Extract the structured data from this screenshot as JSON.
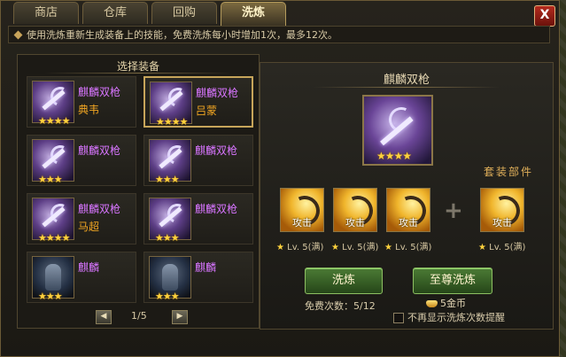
{
  "tabs": [
    {
      "label": "商店",
      "active": false
    },
    {
      "label": "仓库",
      "active": false
    },
    {
      "label": "回购",
      "active": false
    },
    {
      "label": "洗炼",
      "active": true
    }
  ],
  "close_label": "X",
  "tip": "使用洗炼重新生成装备上的技能，免费洗炼每小时增加1次，最多12次。",
  "left_panel": {
    "title": "选择装备",
    "items": [
      {
        "name": "麒麟双枪",
        "owner": "典韦",
        "stars": "★★★★",
        "selected": false,
        "icon": "weapon-icon"
      },
      {
        "name": "麒麟双枪",
        "owner": "吕蒙",
        "stars": "★★★★",
        "selected": true,
        "icon": "weapon-icon"
      },
      {
        "name": "麒麟双枪",
        "owner": "",
        "stars": "★★★",
        "selected": false,
        "icon": "weapon-icon"
      },
      {
        "name": "麒麟双枪",
        "owner": "",
        "stars": "★★★",
        "selected": false,
        "icon": "weapon-icon"
      },
      {
        "name": "麒麟双枪",
        "owner": "马超",
        "stars": "★★★★",
        "selected": false,
        "icon": "weapon-icon"
      },
      {
        "name": "麒麟双枪",
        "owner": "",
        "stars": "★★★",
        "selected": false,
        "icon": "weapon-icon"
      },
      {
        "name": "麒麟",
        "owner": "",
        "stars": "★★★",
        "selected": false,
        "icon": "mount-icon"
      },
      {
        "name": "麒麟",
        "owner": "",
        "stars": "★★★",
        "selected": false,
        "icon": "mount-icon"
      }
    ],
    "page": "1/5"
  },
  "right_panel": {
    "weapon_name": "麒麟双枪",
    "weapon_stars": "★★★★",
    "set_label": "套装部件",
    "parts": [
      {
        "label": "攻击",
        "level": "Lv. 5(满)",
        "star": "★"
      },
      {
        "label": "攻击",
        "level": "Lv. 5(满)",
        "star": "★"
      },
      {
        "label": "攻击",
        "level": "Lv. 5(满)",
        "star": "★"
      },
      {
        "label": "攻击",
        "level": "Lv. 5(满)",
        "star": "★"
      }
    ],
    "plus": "+",
    "refine_button": "洗炼",
    "supreme_button": "至尊洗炼",
    "free_label": "免费次数：5/12",
    "gold_cost": "5金币",
    "checkbox_label": "不再显示洗炼次数提醒"
  }
}
